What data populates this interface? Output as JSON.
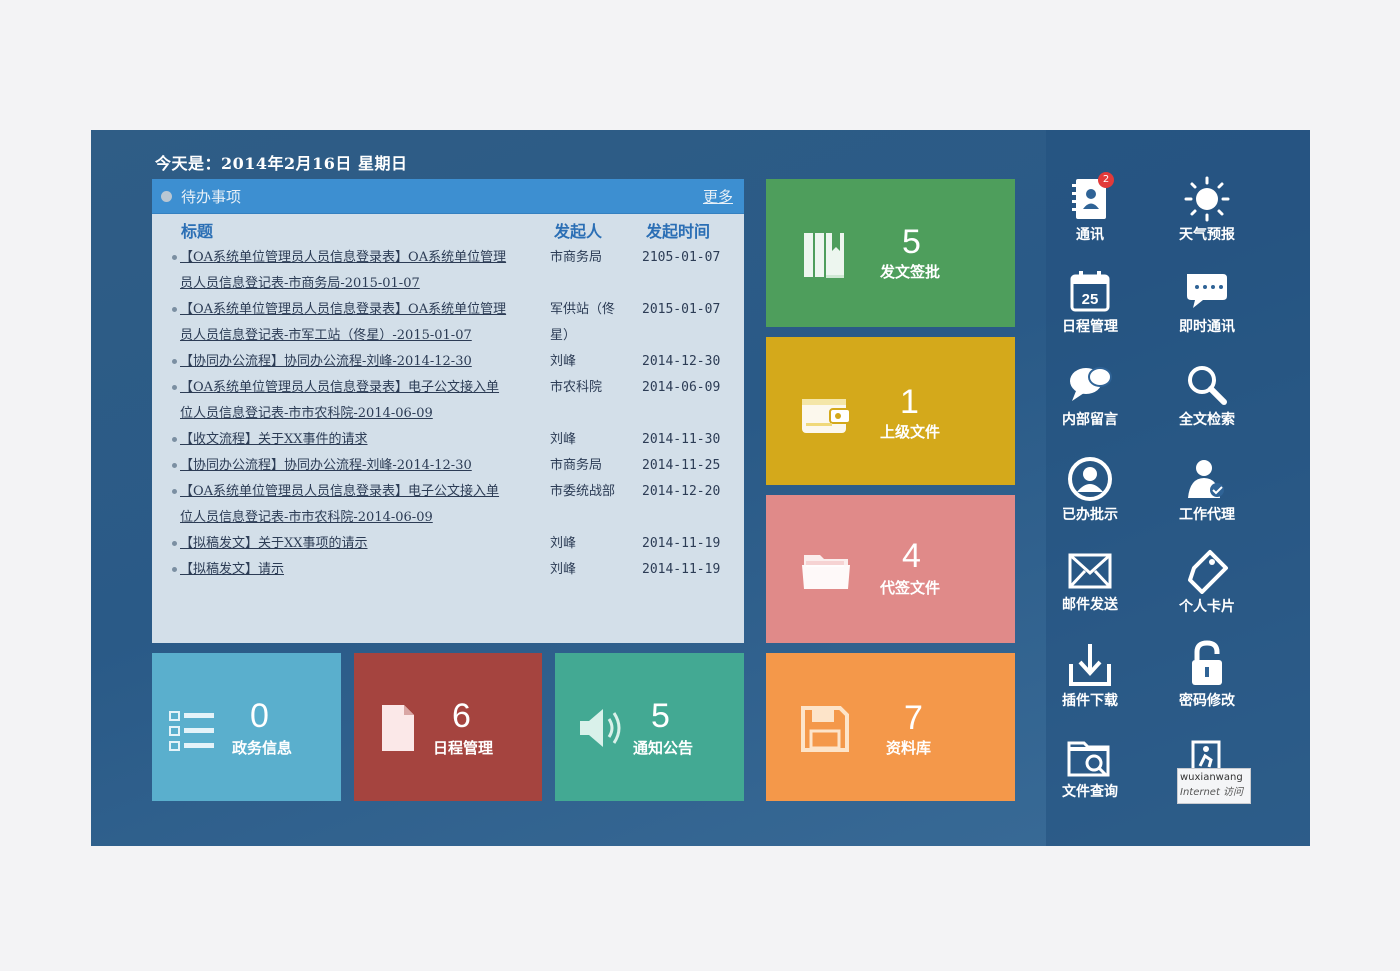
{
  "date_line": "今天是：2014年2月16日  星期日",
  "todo": {
    "title": "待办事项",
    "more": "更多",
    "columns": {
      "title": "标题",
      "sender": "发起人",
      "time": "发起时间"
    },
    "rows": [
      {
        "title_l1": "【OA系统单位管理员人员信息登录表】OA系统单位管理",
        "title_l2": "员人员信息登记表-市商务局-2015-01-07",
        "sender_l1": "市商务局",
        "sender_l2": "",
        "time": "2105-01-07"
      },
      {
        "title_l1": "【OA系统单位管理员人员信息登录表】OA系统单位管理",
        "title_l2": "员人员信息登记表-市军工站（佟星）-2015-01-07",
        "sender_l1": "军供站（佟",
        "sender_l2": "星）",
        "time": "2015-01-07"
      },
      {
        "title_l1": "【协同办公流程】协同办公流程-刘峰-2014-12-30",
        "title_l2": "",
        "sender_l1": "刘峰",
        "sender_l2": "",
        "time": "2014-12-30"
      },
      {
        "title_l1": "【OA系统单位管理员人员信息登录表】电子公文接入单",
        "title_l2": "位人员信息登记表-市市农科院-2014-06-09",
        "sender_l1": "市农科院",
        "sender_l2": "",
        "time": "2014-06-09"
      },
      {
        "title_l1": "【收文流程】关于XX事件的请求",
        "title_l2": "",
        "sender_l1": "刘峰",
        "sender_l2": "",
        "time": "2014-11-30"
      },
      {
        "title_l1": "【协同办公流程】协同办公流程-刘峰-2014-12-30",
        "title_l2": "",
        "sender_l1": "市商务局",
        "sender_l2": "",
        "time": "2014-11-25"
      },
      {
        "title_l1": "【OA系统单位管理员人员信息登录表】电子公文接入单",
        "title_l2": "位人员信息登记表-市市农科院-2014-06-09",
        "sender_l1": "市委统战部",
        "sender_l2": "",
        "time": "2014-12-20"
      },
      {
        "title_l1": "【拟稿发文】关于XX事项的请示",
        "title_l2": "",
        "sender_l1": "刘峰",
        "sender_l2": "",
        "time": "2014-11-19"
      },
      {
        "title_l1": "【拟稿发文】请示",
        "title_l2": "",
        "sender_l1": "刘峰",
        "sender_l2": "",
        "time": "2014-11-19"
      }
    ]
  },
  "tiles": {
    "dispatch": {
      "count": "5",
      "label": "发文签批",
      "color": "#4e9e5c"
    },
    "superior": {
      "count": "1",
      "label": "上级文件",
      "color": "#d4a91b"
    },
    "proxy": {
      "count": "4",
      "label": "代签文件",
      "color": "#e08a89"
    },
    "archive": {
      "count": "7",
      "label": "资料库",
      "color": "#f4984a"
    },
    "gov_info": {
      "count": "0",
      "label": "政务信息",
      "color": "#5aafcd"
    },
    "schedule": {
      "count": "6",
      "label": "日程管理",
      "color": "#a5443f"
    },
    "notice": {
      "count": "5",
      "label": "通知公告",
      "color": "#43a993"
    }
  },
  "sidebar": {
    "contacts": {
      "label": "通讯",
      "badge": "2"
    },
    "weather": {
      "label": "天气预报"
    },
    "schedule": {
      "label": "日程管理",
      "day": "25"
    },
    "im": {
      "label": "即时通讯"
    },
    "message": {
      "label": "内部留言"
    },
    "search": {
      "label": "全文检索"
    },
    "approved": {
      "label": "已办批示"
    },
    "agent": {
      "label": "工作代理"
    },
    "mail": {
      "label": "邮件发送"
    },
    "card": {
      "label": "个人卡片"
    },
    "plugin": {
      "label": "插件下载"
    },
    "password": {
      "label": "密码修改"
    },
    "filequery": {
      "label": "文件查询"
    }
  },
  "ie_tooltip": {
    "line1": "wuxianwang",
    "line2": "Internet 访问"
  }
}
